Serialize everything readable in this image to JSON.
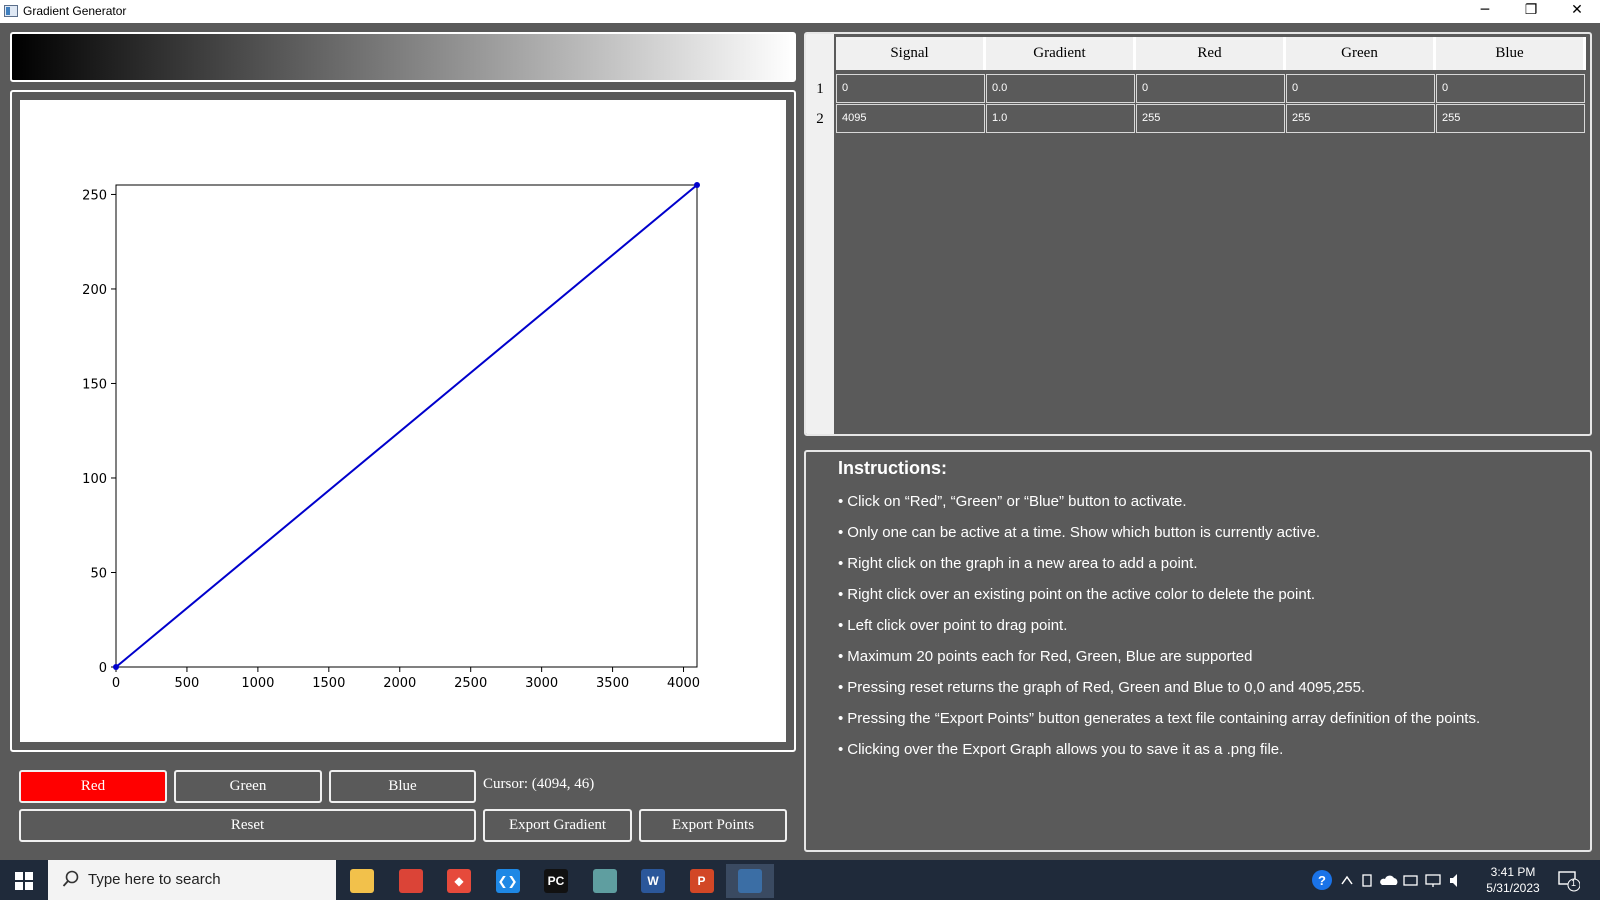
{
  "window": {
    "title": "Gradient Generator",
    "minimize_glyph": "─",
    "restore_glyph": "❐",
    "close_glyph": "✕"
  },
  "gradient_bar": {
    "start_color": "#000000",
    "end_color": "#ffffff"
  },
  "chart_data": {
    "type": "line",
    "title": "",
    "xlabel": "",
    "ylabel": "",
    "xlim": [
      0,
      4095
    ],
    "ylim": [
      0,
      255
    ],
    "xticks": [
      0,
      500,
      1000,
      1500,
      2000,
      2500,
      3000,
      3500,
      4000
    ],
    "yticks": [
      0,
      50,
      100,
      150,
      200,
      250
    ],
    "grid": false,
    "series": [
      {
        "color": "#0000cc",
        "x": [
          0,
          4095
        ],
        "y": [
          0,
          255
        ]
      }
    ]
  },
  "buttons": {
    "red": "Red",
    "green": "Green",
    "blue": "Blue",
    "reset": "Reset",
    "export_gradient": "Export Gradient",
    "export_points": "Export Points",
    "active_color": "#ff0000"
  },
  "cursor_label": "Cursor: (4094, 46)",
  "table": {
    "headers": [
      "Signal",
      "Gradient",
      "Red",
      "Green",
      "Blue"
    ],
    "row_numbers": [
      "1",
      "2"
    ],
    "rows": [
      [
        "0",
        "0.0",
        "0",
        "0",
        "0"
      ],
      [
        "4095",
        "1.0",
        "255",
        "255",
        "255"
      ]
    ]
  },
  "instructions": {
    "title": "Instructions:",
    "items": [
      "Click on “Red”, “Green” or “Blue” button to activate.",
      "Only one can be active at a time. Show which button is currently active.",
      "Right click on the graph in a new area to add a point.",
      "Right click over an existing point on the active color to delete the point.",
      "Left click over point to drag point.",
      "Maximum 20 points each for Red, Green, Blue are supported",
      "Pressing reset returns the graph of Red, Green and Blue to 0,0 and 4095,255.",
      "Pressing the “Export Points” button generates a text file containing array definition of the points.",
      "Clicking over the Export Graph allows you to save it as a .png file."
    ]
  },
  "taskbar": {
    "search_placeholder": "Type here to search",
    "apps": [
      {
        "name": "file-explorer-icon",
        "glyph": "",
        "color": "#f2c14b"
      },
      {
        "name": "chrome-icon",
        "glyph": "",
        "color": "#db4437"
      },
      {
        "name": "git-icon",
        "glyph": "◆",
        "color": "#e64a3b"
      },
      {
        "name": "vscode-icon",
        "glyph": "❮❯",
        "color": "#1e88e5"
      },
      {
        "name": "pycharm-icon",
        "glyph": "PC",
        "color": "#111111"
      },
      {
        "name": "chrome-profile-icon",
        "glyph": "",
        "color": "#5f9ea0"
      },
      {
        "name": "word-icon",
        "glyph": "W",
        "color": "#2b579a"
      },
      {
        "name": "powerpoint-icon",
        "glyph": "P",
        "color": "#d24726"
      },
      {
        "name": "python-app-icon",
        "glyph": "",
        "color": "#3b6ea5"
      }
    ],
    "time": "3:41 PM",
    "date": "5/31/2023",
    "notification_count": "1"
  }
}
